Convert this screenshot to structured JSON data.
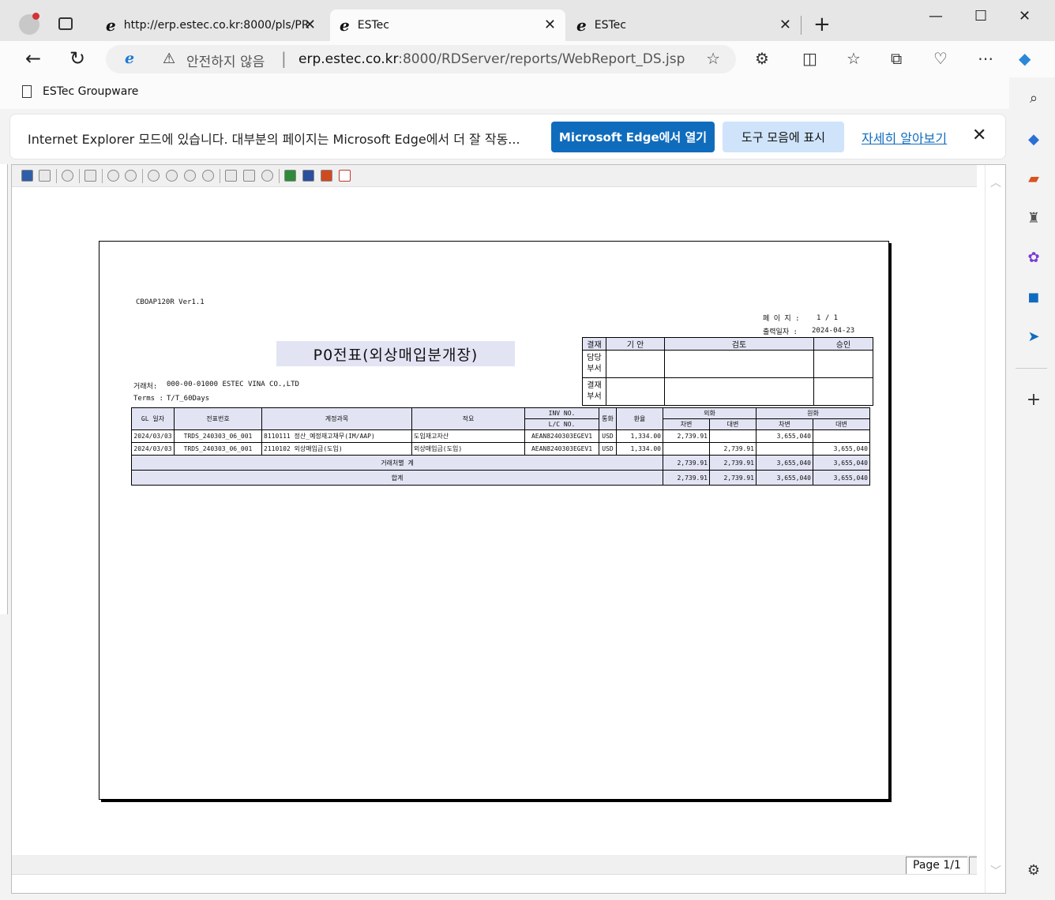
{
  "tabs": [
    {
      "label": "http://erp.estec.co.kr:8000/pls/PR"
    },
    {
      "label": "ESTec"
    },
    {
      "label": "ESTec"
    }
  ],
  "address": {
    "security": "안전하지 않음",
    "host": "erp.estec.co.kr",
    "path": ":8000/RDServer/reports/WebReport_DS.jsp"
  },
  "favorites": [
    {
      "label": "ESTec Groupware"
    }
  ],
  "banner": {
    "message": "Internet Explorer 모드에 있습니다. 대부분의 페이지는 Microsoft Edge에서 더 잘 작동...",
    "open_button": "Microsoft Edge에서 열기",
    "show_button": "도구 모음에 표시",
    "learn_more": "자세히 알아보기"
  },
  "viewer": {
    "page_indicator": "Page 1/1"
  },
  "report": {
    "form_id": "CBOAP120R Ver1.1",
    "title": "P0전표(외상매입분개장)",
    "page_label": "페 이 지 :",
    "page_value": "1 / 1",
    "print_date_label": "출력일자 :",
    "print_date": "2024-04-23",
    "vendor_label": "거래처:",
    "vendor": "000-00-01000 ESTEC VINA CO.,LTD",
    "terms_label": "Terms :",
    "terms": "T/T_60Days",
    "approval": {
      "col_headers": [
        "결재",
        "기 안",
        "검토",
        "승인"
      ],
      "rows": [
        "담당\n부서",
        "결재\n부서"
      ]
    },
    "headers": {
      "gl_date": "GL 일자",
      "voucher_no": "전표번호",
      "account": "계정과목",
      "summary": "적요",
      "inv_no": "INV NO.",
      "lc_no": "L/C NO.",
      "currency": "통화",
      "rate": "환율",
      "foreign": "외화",
      "local": "원화",
      "debit": "차변",
      "credit": "대변"
    },
    "rows": [
      {
        "gl_date": "2024/03/03",
        "voucher_no": "TRDS_240303_06_001",
        "account": "8110111 정산_예정재고채무(IM/AAP)",
        "summary": "도입재고자산",
        "inv_no": "AEAN8240303EGEV1",
        "currency": "USD",
        "rate": "1,334.00",
        "fx_debit": "2,739.91",
        "fx_credit": "",
        "krw_debit": "3,655,040",
        "krw_credit": ""
      },
      {
        "gl_date": "2024/03/03",
        "voucher_no": "TRDS_240303_06_001",
        "account": "2110102 외상매입금(도입)",
        "summary": "외상매입금(도입)",
        "inv_no": "AEAN8240303EGEV1",
        "currency": "USD",
        "rate": "1,334.00",
        "fx_debit": "",
        "fx_credit": "2,739.91",
        "krw_debit": "",
        "krw_credit": "3,655,040"
      }
    ],
    "subtotal": {
      "label": "거래처별 계",
      "fx_debit": "2,739.91",
      "fx_credit": "2,739.91",
      "krw_debit": "3,655,040",
      "krw_credit": "3,655,040"
    },
    "total": {
      "label": "합계",
      "fx_debit": "2,739.91",
      "fx_credit": "2,739.91",
      "krw_debit": "3,655,040",
      "krw_credit": "3,655,040"
    }
  }
}
